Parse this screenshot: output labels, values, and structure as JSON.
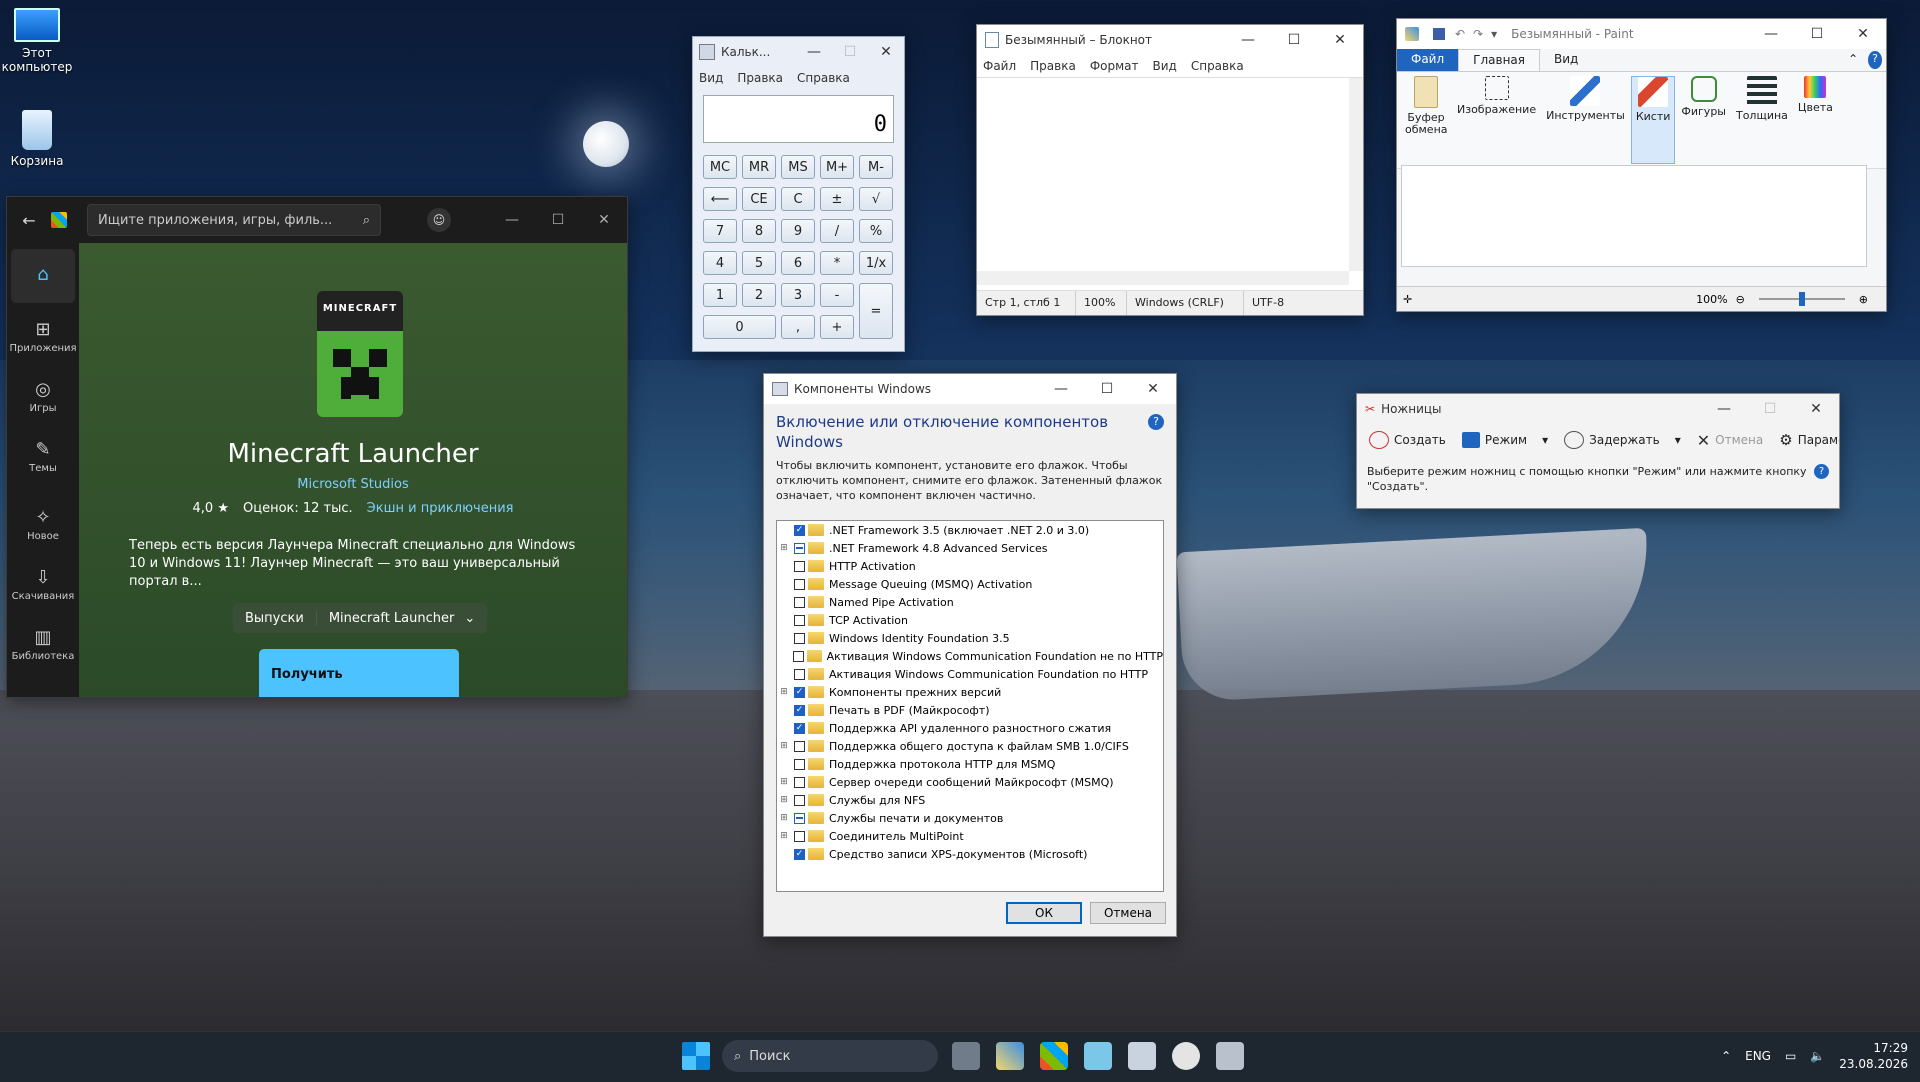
{
  "desktop": {
    "icons": [
      {
        "label": "Этот компьютер"
      },
      {
        "label": "Корзина"
      }
    ]
  },
  "store": {
    "search_placeholder": "Ищите приложения, игры, филь...",
    "sidebar": [
      "",
      "Приложения",
      "Игры",
      "Темы",
      "Новое",
      "Скачивания",
      "Библиотека"
    ],
    "logo_text": "MINECRAFT",
    "app_title": "Minecraft Launcher",
    "publisher": "Microsoft Studios",
    "rating": "4,0 ★",
    "reviews": "Оценок: 12 тыс.",
    "category": "Экшн и приключения",
    "description": "Теперь есть версия Лаунчера Minecraft специально для Windows 10 и Windows 11! Лаунчер Minecraft — это ваш универсальный портал в...",
    "editions_label": "Выпуски",
    "edition_value": "Minecraft Launcher",
    "get_label": "Получить"
  },
  "calc": {
    "title": "Кальк...",
    "menu": [
      "Вид",
      "Правка",
      "Справка"
    ],
    "display": "0",
    "keys": [
      [
        "MC",
        "MR",
        "MS",
        "M+",
        "M-"
      ],
      [
        "⟵",
        "CE",
        "C",
        "±",
        "√"
      ],
      [
        "7",
        "8",
        "9",
        "/",
        "%"
      ],
      [
        "4",
        "5",
        "6",
        "*",
        "1/x"
      ],
      [
        "1",
        "2",
        "3",
        "-",
        "="
      ],
      [
        "0",
        ",",
        "+"
      ]
    ]
  },
  "notepad": {
    "title": "Безымянный – Блокнот",
    "menu": [
      "Файл",
      "Правка",
      "Формат",
      "Вид",
      "Справка"
    ],
    "status": [
      "Стр 1, стлб 1",
      "100%",
      "Windows (CRLF)",
      "UTF-8"
    ]
  },
  "paint": {
    "title": "Безымянный - Paint",
    "tabs": [
      "Файл",
      "Главная",
      "Вид"
    ],
    "groups": [
      "Буфер обмена",
      "Изображение",
      "Инструменты",
      "Кисти",
      "Фигуры",
      "Толщина",
      "Цвета"
    ],
    "zoom": "100%"
  },
  "features": {
    "title": "Компоненты Windows",
    "heading": "Включение или отключение компонентов Windows",
    "description": "Чтобы включить компонент, установите его флажок. Чтобы отключить компонент, снимите его флажок. Затененный флажок означает, что компонент включен частично.",
    "items": [
      {
        "label": ".NET Framework 3.5 (включает .NET 2.0 и 3.0)",
        "expand": false,
        "state": "on"
      },
      {
        "label": ".NET Framework 4.8 Advanced Services",
        "expand": true,
        "state": "part"
      },
      {
        "label": "HTTP Activation",
        "expand": false,
        "state": "off"
      },
      {
        "label": "Message Queuing (MSMQ) Activation",
        "expand": false,
        "state": "off"
      },
      {
        "label": "Named Pipe Activation",
        "expand": false,
        "state": "off"
      },
      {
        "label": "TCP Activation",
        "expand": false,
        "state": "off"
      },
      {
        "label": "Windows Identity Foundation 3.5",
        "expand": false,
        "state": "off"
      },
      {
        "label": "Активация Windows Communication Foundation не по HTTP",
        "expand": false,
        "state": "off"
      },
      {
        "label": "Активация Windows Communication Foundation по HTTP",
        "expand": false,
        "state": "off"
      },
      {
        "label": "Компоненты прежних версий",
        "expand": true,
        "state": "on"
      },
      {
        "label": "Печать в PDF (Майкрософт)",
        "expand": false,
        "state": "on"
      },
      {
        "label": "Поддержка API удаленного разностного сжатия",
        "expand": false,
        "state": "on"
      },
      {
        "label": "Поддержка общего доступа к файлам SMB 1.0/CIFS",
        "expand": true,
        "state": "off"
      },
      {
        "label": "Поддержка протокола HTTP для MSMQ",
        "expand": false,
        "state": "off"
      },
      {
        "label": "Сервер очереди сообщений Майкрософт (MSMQ)",
        "expand": true,
        "state": "off"
      },
      {
        "label": "Службы для NFS",
        "expand": true,
        "state": "off"
      },
      {
        "label": "Службы печати и документов",
        "expand": true,
        "state": "part"
      },
      {
        "label": "Соединитель MultiPoint",
        "expand": true,
        "state": "off"
      },
      {
        "label": "Средство записи XPS-документов (Microsoft)",
        "expand": false,
        "state": "on"
      }
    ],
    "ok": "ОК",
    "cancel": "Отмена"
  },
  "snip": {
    "title": "Ножницы",
    "tools": [
      "Создать",
      "Режим",
      "Задержать",
      "Отмена",
      "Параметры"
    ],
    "hint": "Выберите режим ножниц с помощью кнопки \"Режим\" или нажмите кнопку \"Создать\"."
  },
  "taskbar": {
    "search": "Поиск",
    "lang": "ENG",
    "time": "17:29",
    "date": "23.08.2026"
  }
}
